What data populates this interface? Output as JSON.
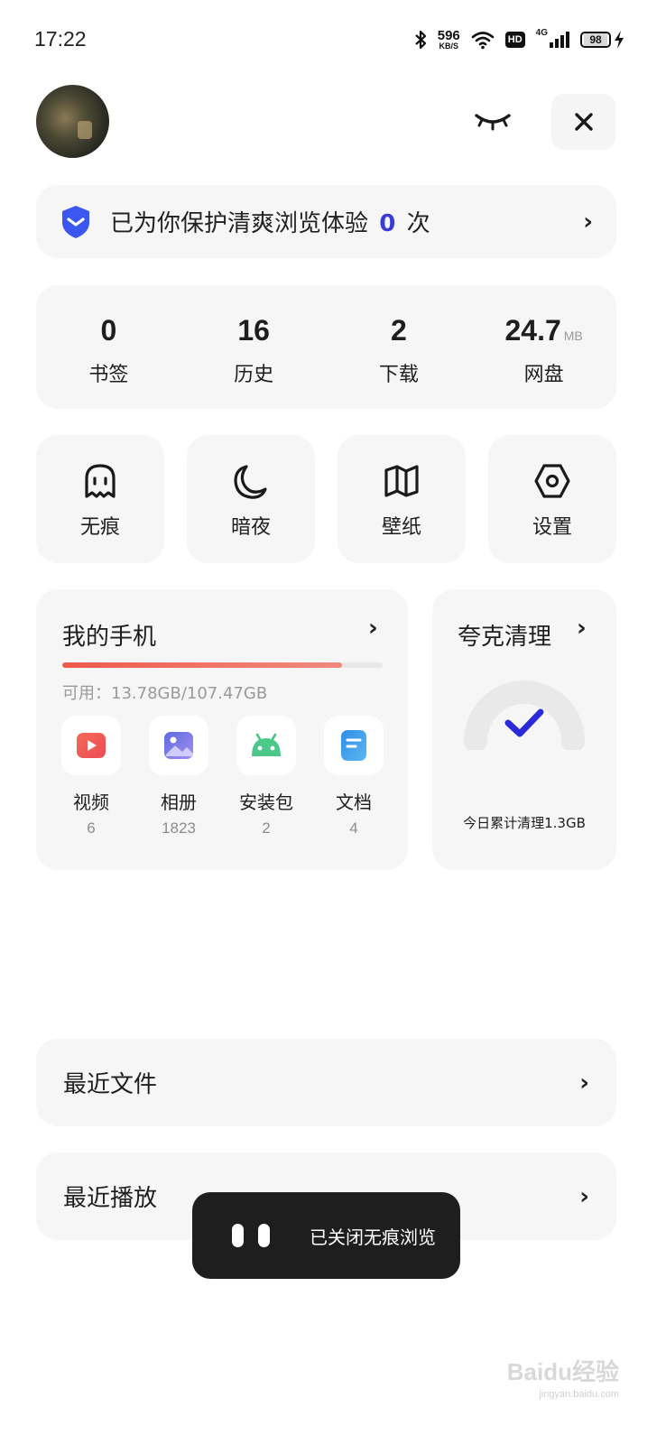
{
  "status_bar": {
    "time": "17:22",
    "speed_value": "596",
    "speed_unit": "KB/S",
    "hd_label": "HD",
    "network_label": "4G",
    "battery_level": "98",
    "icons": [
      "bluetooth-icon",
      "wifi-icon",
      "signal-icon",
      "battery-icon",
      "charging-icon"
    ]
  },
  "header": {
    "icons": [
      "avatar",
      "eye-closed-icon",
      "close-icon"
    ]
  },
  "protect_banner": {
    "text_before": "已为你保护清爽浏览体验",
    "count": "0",
    "text_after": "次",
    "icon": "shield-icon",
    "accent_color": "#3b3bd6"
  },
  "stats": [
    {
      "value": "0",
      "unit": "",
      "label": "书签"
    },
    {
      "value": "16",
      "unit": "",
      "label": "历史"
    },
    {
      "value": "2",
      "unit": "",
      "label": "下载"
    },
    {
      "value": "24.7",
      "unit": "MB",
      "label": "网盘"
    }
  ],
  "quick_actions": [
    {
      "label": "无痕",
      "icon": "ghost-icon"
    },
    {
      "label": "暗夜",
      "icon": "moon-icon"
    },
    {
      "label": "壁纸",
      "icon": "map-icon"
    },
    {
      "label": "设置",
      "icon": "hexagon-settings-icon"
    }
  ],
  "my_phone": {
    "title": "我的手机",
    "storage_label": "可用：13.78GB/107.47GB",
    "storage_used_fraction": 0.872,
    "storage_color": "#ef5a4d",
    "apps": [
      {
        "name": "视频",
        "count": "6",
        "icon": "video-icon",
        "color": "#f05a4a"
      },
      {
        "name": "相册",
        "count": "1823",
        "icon": "photo-icon",
        "color": "#6f75e0"
      },
      {
        "name": "安装包",
        "count": "2",
        "icon": "android-icon",
        "color": "#4cc98a"
      },
      {
        "name": "文档",
        "count": "4",
        "icon": "document-icon",
        "color": "#3a9be8"
      }
    ]
  },
  "cleaner": {
    "title": "夸克清理",
    "subtitle": "今日累计清理1.3GB",
    "icon": "check-icon",
    "check_color": "#2a2ad9"
  },
  "rows": [
    {
      "label": "最近文件"
    },
    {
      "label": "最近播放"
    }
  ],
  "toast": {
    "message": "已关闭无痕浏览"
  },
  "watermark": {
    "brand": "Baidu经验",
    "url": "jingyan.baidu.com"
  }
}
